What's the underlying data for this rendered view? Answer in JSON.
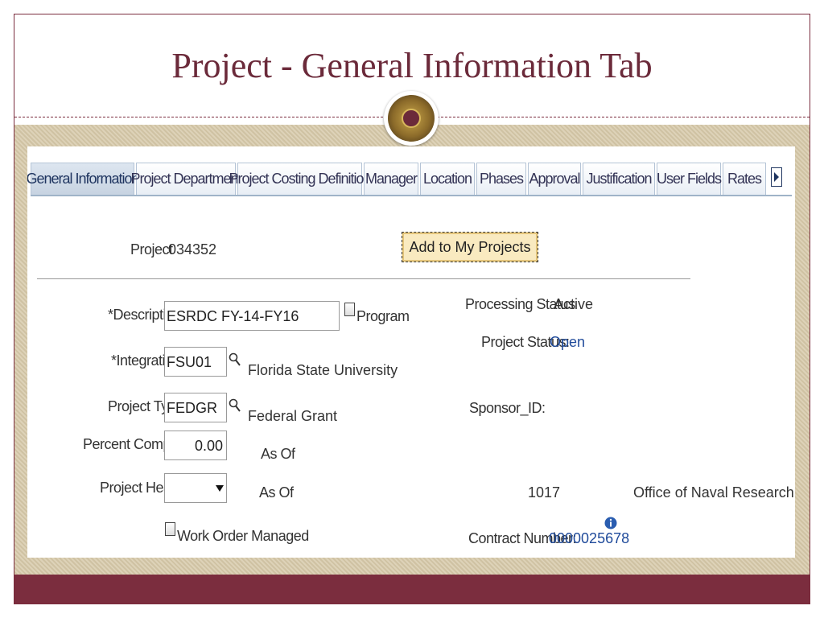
{
  "slide": {
    "title": "Project - General Information Tab"
  },
  "tabs": [
    {
      "label": "General Information",
      "active": true
    },
    {
      "label": "Project Department"
    },
    {
      "label": "Project Costing Definition"
    },
    {
      "label": "Manager"
    },
    {
      "label": "Location"
    },
    {
      "label": "Phases"
    },
    {
      "label": "Approval"
    },
    {
      "label": "Justification"
    },
    {
      "label": "User Fields"
    },
    {
      "label": "Rates"
    }
  ],
  "header": {
    "project_label": "Project",
    "project_id": "034352",
    "add_button": "Add to My Projects"
  },
  "form": {
    "description": {
      "label": "*Description",
      "value": "ESRDC FY-14-FY16",
      "program_label": "Program"
    },
    "integration": {
      "label": "*Integration",
      "value": "FSU01",
      "name": "Florida State University"
    },
    "project_type": {
      "label": "Project Type",
      "value": "FEDGR",
      "name": "Federal Grant"
    },
    "percent_complete": {
      "label": "Percent Complete",
      "value": "0.00",
      "as_of": "As Of"
    },
    "project_health": {
      "label": "Project Health",
      "value": "",
      "as_of": "As Of"
    },
    "work_order": {
      "label": "Work Order Managed"
    }
  },
  "status": {
    "processing_label": "Processing Status",
    "processing_value": "Active",
    "project_status_label": "Project Status:",
    "project_status_value": "Open",
    "sponsor_label": "Sponsor_ID:",
    "sponsor_code": "1017",
    "sponsor_name": "Office of Naval Research",
    "contract_label": "Contract Number:",
    "contract_value": "0000025678"
  },
  "colors": {
    "brand": "#7b2d3e",
    "tan": "#d6c8a8",
    "link": "#1f4a9a"
  },
  "icons": [
    "lookup-icon",
    "info-icon",
    "next-tab-arrow-icon",
    "dropdown-arrow-icon",
    "university-seal-icon"
  ]
}
